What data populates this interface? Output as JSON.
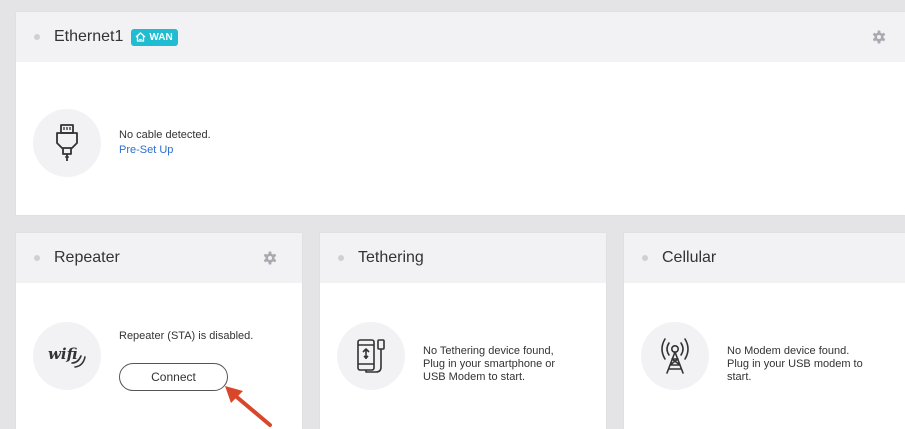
{
  "ethernet": {
    "title": "Ethernet1",
    "badge": "WAN",
    "message": "No cable detected.",
    "link": "Pre-Set Up",
    "icon": "ethernet-plug-icon"
  },
  "repeater": {
    "title": "Repeater",
    "message": "Repeater (STA) is disabled.",
    "button": "Connect",
    "icon": "wifi-icon"
  },
  "tethering": {
    "title": "Tethering",
    "message_lines": [
      "No Tethering device found,",
      "Plug in your smartphone or",
      "USB Modem to start."
    ],
    "icon": "phone-usb-icon"
  },
  "cellular": {
    "title": "Cellular",
    "message_lines": [
      "No Modem device found.",
      "Plug in your USB modem to",
      "start."
    ],
    "icon": "cell-tower-icon"
  },
  "colors": {
    "accent": "#1fbcd2",
    "link": "#2d6fcf",
    "arrow": "#d9472b"
  }
}
